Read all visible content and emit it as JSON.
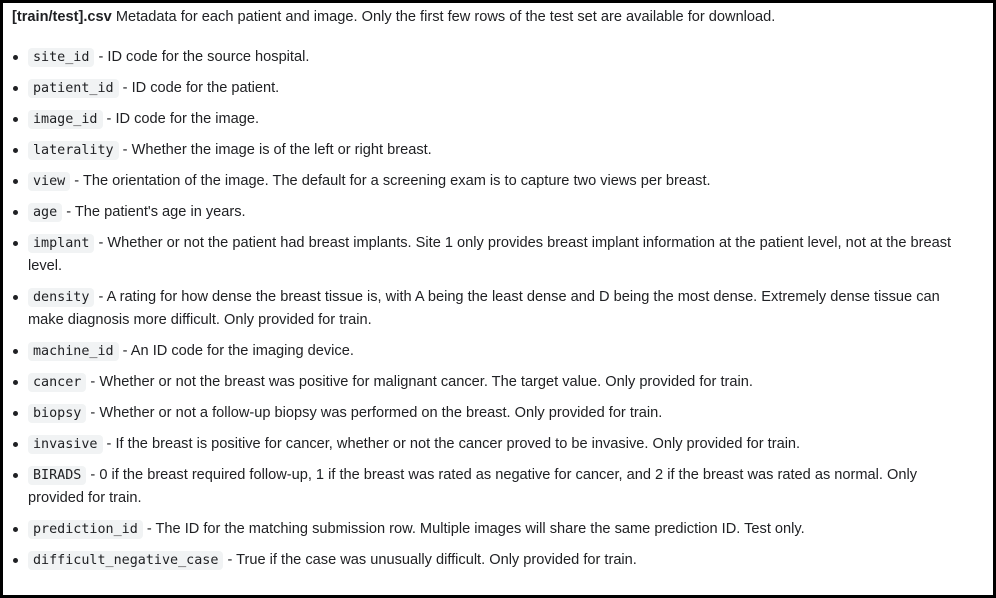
{
  "intro": {
    "file": "[train/test].csv",
    "text": " Metadata for each patient and image. Only the first few rows of the test set are available for download."
  },
  "fields": [
    {
      "name": "site_id",
      "desc": " - ID code for the source hospital."
    },
    {
      "name": "patient_id",
      "desc": " - ID code for the patient."
    },
    {
      "name": "image_id",
      "desc": " - ID code for the image."
    },
    {
      "name": "laterality",
      "desc": " - Whether the image is of the left or right breast."
    },
    {
      "name": "view",
      "desc": " - The orientation of the image. The default for a screening exam is to capture two views per breast."
    },
    {
      "name": "age",
      "desc": " - The patient's age in years."
    },
    {
      "name": "implant",
      "desc": " - Whether or not the patient had breast implants. Site 1 only provides breast implant information at the patient level, not at the breast level."
    },
    {
      "name": "density",
      "desc": " - A rating for how dense the breast tissue is, with A being the least dense and D being the most dense. Extremely dense tissue can make diagnosis more difficult. Only provided for train."
    },
    {
      "name": "machine_id",
      "desc": " - An ID code for the imaging device."
    },
    {
      "name": "cancer",
      "desc": " - Whether or not the breast was positive for malignant cancer. The target value. Only provided for train."
    },
    {
      "name": "biopsy",
      "desc": " - Whether or not a follow-up biopsy was performed on the breast. Only provided for train."
    },
    {
      "name": "invasive",
      "desc": " - If the breast is positive for cancer, whether or not the cancer proved to be invasive. Only provided for train."
    },
    {
      "name": "BIRADS",
      "desc": " - 0 if the breast required follow-up, 1 if the breast was rated as negative for cancer, and 2 if the breast was rated as normal. Only provided for train."
    },
    {
      "name": "prediction_id",
      "desc": " - The ID for the matching submission row. Multiple images will share the same prediction ID. Test only."
    },
    {
      "name": "difficult_negative_case",
      "desc": " - True if the case was unusually difficult. Only provided for train."
    }
  ]
}
